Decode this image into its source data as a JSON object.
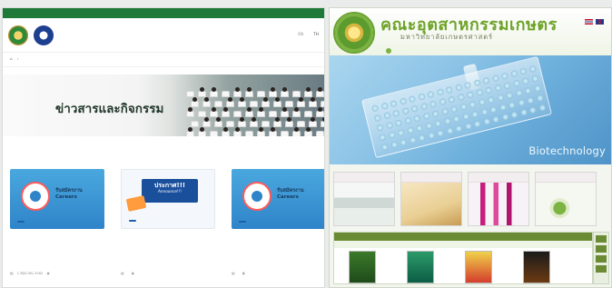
{
  "left": {
    "topbar_links": [
      "",
      "",
      "",
      ""
    ],
    "nav": {
      "items": [
        "",
        "",
        "",
        "",
        ""
      ],
      "active": "",
      "lang_en": "EN",
      "lang_th": "TH"
    },
    "breadcrumb": "",
    "hero_title": "ข่าวสารและกิจกรรม",
    "cards": [
      {
        "thumb_line1": "รับสมัครงาน",
        "thumb_line2": "Careers",
        "tag": "",
        "title": "",
        "text": "",
        "date": "1 มิถุนายน 2562",
        "views": "",
        "style": "blue"
      },
      {
        "thumb_line1": "ประกาศ!!!",
        "thumb_line2": "Announce!!!",
        "tag": "",
        "title": "",
        "text": "",
        "date": "",
        "views": "",
        "style": "white"
      },
      {
        "thumb_line1": "รับสมัครงาน",
        "thumb_line2": "Careers",
        "tag": "",
        "title": "",
        "text": "",
        "date": "",
        "views": "",
        "style": "blue"
      }
    ]
  },
  "right": {
    "faculty_name": "คณะอุตสาหกรรมเกษตร",
    "university_name": "มหาวิทยาลัยเกษตรศาสตร์",
    "lang_label": "",
    "nav": [
      "",
      "",
      "",
      "",
      ""
    ],
    "banner_text": "Biotechnology",
    "tiles": [
      "",
      "",
      "",
      ""
    ],
    "news": {
      "heading": "",
      "tabs": [
        "",
        "",
        "",
        "",
        "",
        ""
      ]
    }
  },
  "colors": {
    "left_accent": "#1f7a3a",
    "right_green": "#6fa32a",
    "right_magenta": "#b5186e",
    "card_blue": "#2f84c9"
  }
}
